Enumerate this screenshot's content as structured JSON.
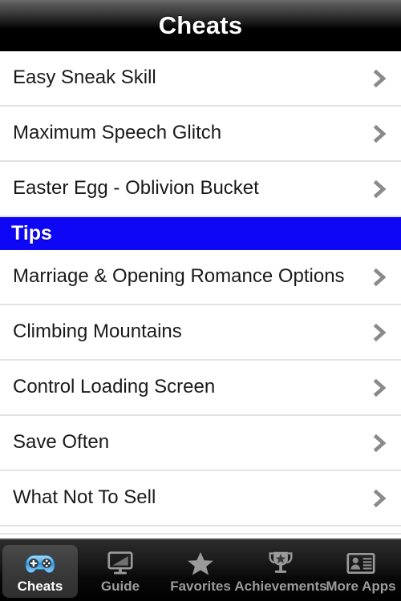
{
  "navbar": {
    "title": "Cheats"
  },
  "list": {
    "items": [
      {
        "type": "row",
        "label": "Easy Sneak Skill",
        "accessory": "chevron-right-icon"
      },
      {
        "type": "row",
        "label": "Maximum Speech Glitch",
        "accessory": "chevron-right-icon"
      },
      {
        "type": "row",
        "label": "Easter Egg - Oblivion Bucket",
        "accessory": "chevron-right-icon"
      },
      {
        "type": "section",
        "label": "Tips"
      },
      {
        "type": "row",
        "label": "Marriage & Opening Romance Options",
        "accessory": "chevron-right-icon"
      },
      {
        "type": "row",
        "label": "Climbing Mountains",
        "accessory": "chevron-right-icon"
      },
      {
        "type": "row",
        "label": "Control Loading Screen",
        "accessory": "chevron-right-icon"
      },
      {
        "type": "row",
        "label": "Save Often",
        "accessory": "chevron-right-icon"
      },
      {
        "type": "row",
        "label": "What Not To Sell",
        "accessory": "chevron-right-icon"
      }
    ]
  },
  "tabbar": {
    "tabs": [
      {
        "label": "Cheats",
        "icon": "gamepad-icon",
        "active": true
      },
      {
        "label": "Guide",
        "icon": "monitor-icon",
        "active": false
      },
      {
        "label": "Favorites",
        "icon": "star-icon",
        "active": false
      },
      {
        "label": "Achievements",
        "icon": "trophy-icon",
        "active": false
      },
      {
        "label": "More Apps",
        "icon": "contact-card-icon",
        "active": false
      }
    ]
  },
  "colors": {
    "section_blue": "#0d07f5",
    "chevron_gray": "#8a8a8a",
    "row_separator": "#e3e3e3",
    "tab_inactive_text": "#9b9b9b",
    "tab_active_text": "#ffffff",
    "accent_icon_blue": "#5fb8f0"
  }
}
